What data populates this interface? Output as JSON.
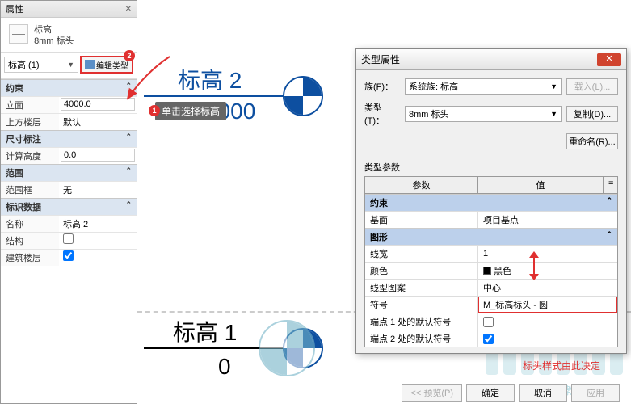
{
  "panel": {
    "title": "属性",
    "type_name": "标高",
    "type_sub": "8mm 标头",
    "instance": "标高 (1)",
    "edit_type": "编辑类型",
    "sections": {
      "constraints": "约束",
      "dimensions": "尺寸标注",
      "extents": "范围",
      "identity": "标识数据"
    },
    "rows": {
      "elevation_k": "立面",
      "elevation_v": "4000.0",
      "story_above_k": "上方楼层",
      "story_above_v": "默认",
      "compute_h_k": "计算高度",
      "compute_h_v": "0.0",
      "scope_box_k": "范围框",
      "scope_box_v": "无",
      "name_k": "名称",
      "name_v": "标高 2",
      "structural_k": "结构",
      "building_story_k": "建筑楼层"
    }
  },
  "canvas": {
    "level2_label": "标高 2",
    "level2_val": "4000",
    "level1_label": "标高 1",
    "level1_val": "0",
    "tooltip": "单击选择标高"
  },
  "badges": {
    "one": "1",
    "two": "2"
  },
  "dialog": {
    "title": "类型属性",
    "family_lbl": "族(F)：",
    "family_v": "系统族: 标高",
    "type_lbl": "类型(T)：",
    "type_v": "8mm 标头",
    "btn_load": "载入(L)...",
    "btn_dup": "复制(D)...",
    "btn_rename": "重命名(R)...",
    "tp_title": "类型参数",
    "col_param": "参数",
    "col_val": "值",
    "col_eq": "=",
    "sec_constraints": "约束",
    "r_base_k": "基面",
    "r_base_v": "项目基点",
    "sec_graphics": "图形",
    "r_lw_k": "线宽",
    "r_lw_v": "1",
    "r_color_k": "颜色",
    "r_color_v": "黑色",
    "r_pattern_k": "线型图案",
    "r_pattern_v": "中心",
    "r_symbol_k": "符号",
    "r_symbol_v": "M_标高标头 - 圆",
    "r_end1_k": "端点 1 处的默认符号",
    "r_end2_k": "端点 2 处的默认符号",
    "note": "标头样式由此决定",
    "btn_preview": "<< 预览(P)",
    "btn_ok": "确定",
    "btn_cancel": "取消",
    "btn_apply": "应用"
  },
  "watermark": "腿腿教学网"
}
